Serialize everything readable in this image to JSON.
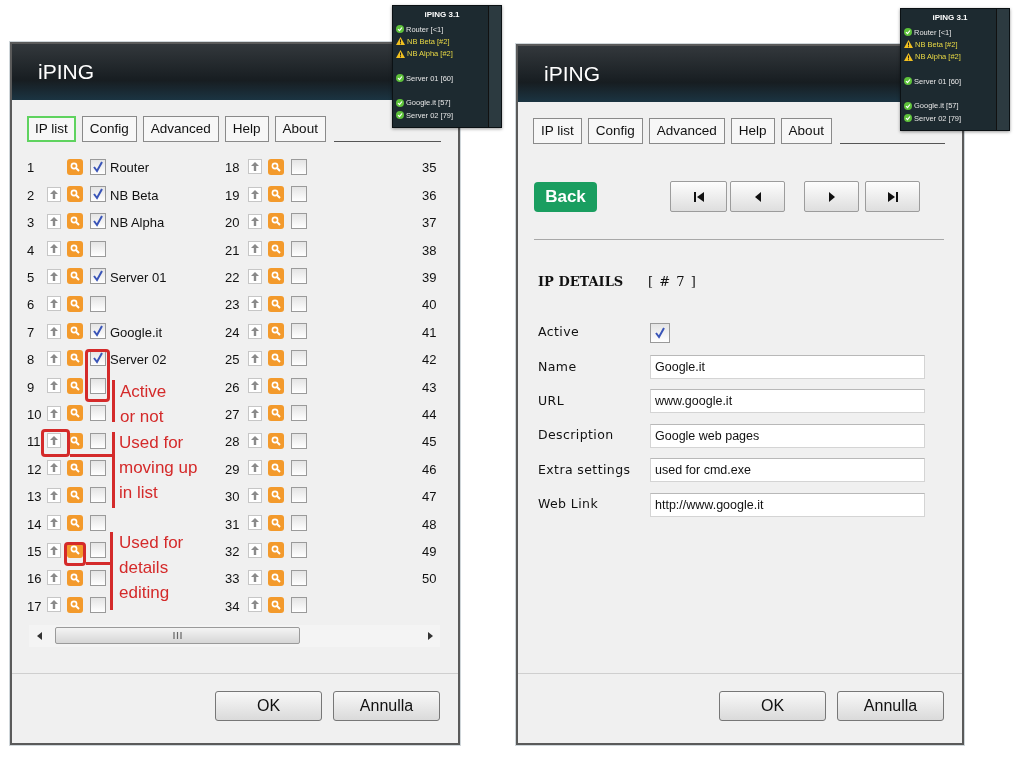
{
  "left_window": {
    "title": "iPING",
    "tabs": [
      {
        "label": "IP list",
        "selected": true
      },
      {
        "label": "Config",
        "selected": false
      },
      {
        "label": "Advanced",
        "selected": false
      },
      {
        "label": "Help",
        "selected": false
      },
      {
        "label": "About",
        "selected": false
      }
    ],
    "list_columns": [
      {
        "kind": "entries",
        "rows": [
          {
            "number": "1",
            "name": "Router",
            "active": true,
            "can_move_up": false
          },
          {
            "number": "2",
            "name": "NB Beta",
            "active": true,
            "can_move_up": true
          },
          {
            "number": "3",
            "name": "NB Alpha",
            "active": true,
            "can_move_up": true
          },
          {
            "number": "4",
            "active": false,
            "can_move_up": true
          },
          {
            "number": "5",
            "name": "Server 01",
            "active": true,
            "can_move_up": true
          },
          {
            "number": "6",
            "active": false,
            "can_move_up": true
          },
          {
            "number": "7",
            "name": "Google.it",
            "active": true,
            "can_move_up": true
          },
          {
            "number": "8",
            "name": "Server 02",
            "active": true,
            "can_move_up": true
          },
          {
            "number": "9",
            "active": false,
            "can_move_up": true
          },
          {
            "number": "10",
            "active": false,
            "can_move_up": true
          },
          {
            "number": "11",
            "active": false,
            "can_move_up": true
          },
          {
            "number": "12",
            "active": false,
            "can_move_up": true
          },
          {
            "number": "13",
            "active": false,
            "can_move_up": true
          },
          {
            "number": "14",
            "active": false,
            "can_move_up": true
          },
          {
            "number": "15",
            "active": false,
            "can_move_up": true
          },
          {
            "number": "16",
            "active": false,
            "can_move_up": true
          },
          {
            "number": "17",
            "active": false,
            "can_move_up": true
          }
        ]
      },
      {
        "kind": "entries",
        "rows": [
          {
            "number": "18",
            "active": false,
            "can_move_up": true
          },
          {
            "number": "19",
            "active": false,
            "can_move_up": true
          },
          {
            "number": "20",
            "active": false,
            "can_move_up": true
          },
          {
            "number": "21",
            "active": false,
            "can_move_up": true
          },
          {
            "number": "22",
            "active": false,
            "can_move_up": true
          },
          {
            "number": "23",
            "active": false,
            "can_move_up": true
          },
          {
            "number": "24",
            "active": false,
            "can_move_up": true
          },
          {
            "number": "25",
            "active": false,
            "can_move_up": true
          },
          {
            "number": "26",
            "active": false,
            "can_move_up": true
          },
          {
            "number": "27",
            "active": false,
            "can_move_up": true
          },
          {
            "number": "28",
            "active": false,
            "can_move_up": true
          },
          {
            "number": "29",
            "active": false,
            "can_move_up": true
          },
          {
            "number": "30",
            "active": false,
            "can_move_up": true
          },
          {
            "number": "31",
            "active": false,
            "can_move_up": true
          },
          {
            "number": "32",
            "active": false,
            "can_move_up": true
          },
          {
            "number": "33",
            "active": false,
            "can_move_up": true
          },
          {
            "number": "34",
            "active": false,
            "can_move_up": true
          }
        ]
      },
      {
        "kind": "numbers_only",
        "rows": [
          {
            "number": "35"
          },
          {
            "number": "36"
          },
          {
            "number": "37"
          },
          {
            "number": "38"
          },
          {
            "number": "39"
          },
          {
            "number": "40"
          },
          {
            "number": "41"
          },
          {
            "number": "42"
          },
          {
            "number": "43"
          },
          {
            "number": "44"
          },
          {
            "number": "45"
          },
          {
            "number": "46"
          },
          {
            "number": "47"
          },
          {
            "number": "48"
          },
          {
            "number": "49"
          },
          {
            "number": "50"
          }
        ]
      }
    ],
    "annotations": [
      {
        "lines": [
          "Active",
          "or not"
        ]
      },
      {
        "lines": [
          "Used for",
          "moving up",
          "in list"
        ]
      },
      {
        "lines": [
          "Used for",
          "details",
          "editing"
        ]
      }
    ],
    "buttons": [
      "OK",
      "Annulla"
    ]
  },
  "right_window": {
    "title": "iPING",
    "tabs": [
      {
        "label": "IP list",
        "selected": false
      },
      {
        "label": "Config",
        "selected": false
      },
      {
        "label": "Advanced",
        "selected": false
      },
      {
        "label": "Help",
        "selected": false
      },
      {
        "label": "About",
        "selected": false
      }
    ],
    "back_button": "Back",
    "section_title": "IP DETAILS",
    "record_number": "[ # 7 ]",
    "fields": [
      {
        "label": "Active",
        "kind": "checkbox",
        "checked": true
      },
      {
        "label": "Name",
        "kind": "text",
        "value": "Google.it"
      },
      {
        "label": "URL",
        "kind": "text",
        "value": "www.google.it"
      },
      {
        "label": "Description",
        "kind": "text",
        "value": "Google web pages"
      },
      {
        "label": "Extra settings",
        "kind": "text",
        "value": "used for cmd.exe"
      },
      {
        "label": "Web Link",
        "kind": "text",
        "value": "http://www.google.it"
      }
    ],
    "buttons": [
      "OK",
      "Annulla"
    ]
  },
  "status_widgets": [
    {
      "title": "iPING 3.1",
      "entries": [
        {
          "kind": "host",
          "label": "Router [<1]",
          "warning": false
        },
        {
          "kind": "host",
          "label": "NB Beta [#2]",
          "warning": true
        },
        {
          "kind": "host",
          "label": "NB Alpha [#2]",
          "warning": true
        },
        {
          "kind": "gap"
        },
        {
          "kind": "host",
          "label": "Server 01 [60]",
          "warning": false
        },
        {
          "kind": "gap"
        },
        {
          "kind": "host",
          "label": "Google.it [57]",
          "warning": false
        },
        {
          "kind": "host",
          "label": "Server 02 [79]",
          "warning": false
        }
      ]
    },
    {
      "title": "iPING 3.1",
      "entries": [
        {
          "kind": "host",
          "label": "Router [<1]",
          "warning": false
        },
        {
          "kind": "host",
          "label": "NB Beta [#2]",
          "warning": true
        },
        {
          "kind": "host",
          "label": "NB Alpha [#2]",
          "warning": true
        },
        {
          "kind": "gap"
        },
        {
          "kind": "host",
          "label": "Server 01 [60]",
          "warning": false
        },
        {
          "kind": "gap"
        },
        {
          "kind": "host",
          "label": "Google.it [57]",
          "warning": false
        },
        {
          "kind": "host",
          "label": "Server 02 [79]",
          "warning": false
        }
      ]
    }
  ]
}
